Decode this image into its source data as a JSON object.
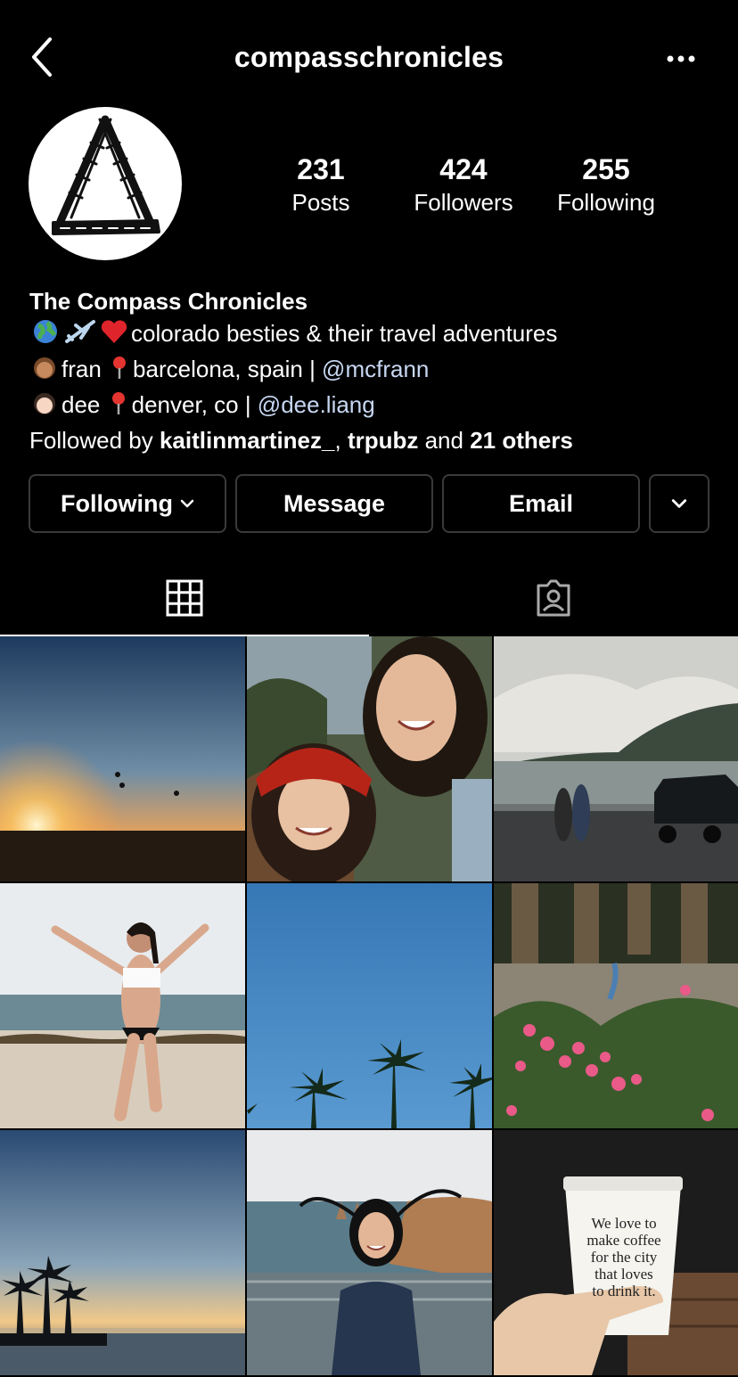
{
  "header": {
    "username": "compasschronicles",
    "back_icon": "chevron-left-icon",
    "more_icon": "more-horizontal-icon"
  },
  "stats": [
    {
      "value": "231",
      "label": "Posts"
    },
    {
      "value": "424",
      "label": "Followers"
    },
    {
      "value": "255",
      "label": "Following"
    }
  ],
  "bio": {
    "name": "The Compass Chronicles",
    "line1_text": "colorado besties & their travel adventures",
    "line2_name": "fran",
    "line2_loc": "barcelona, spain | ",
    "line2_handle": "@mcfrann",
    "line3_name": "dee",
    "line3_loc": "denver, co | ",
    "line3_handle": "@dee.liang",
    "followed_prefix": "Followed by ",
    "followed_user1": "kaitlinmartinez_",
    "followed_sep": ", ",
    "followed_user2": "trpubz",
    "followed_and": " and ",
    "followed_others": "21 others"
  },
  "buttons": {
    "following": "Following",
    "message": "Message",
    "email": "Email"
  },
  "tabs": {
    "grid_icon": "grid-icon",
    "tagged_icon": "tagged-person-icon",
    "active": "grid"
  },
  "colors": {
    "background": "#000000",
    "mention": "#c7d7f2",
    "button_border": "#3a3a3a"
  },
  "posts": [
    {
      "scene": "sunset-balloons"
    },
    {
      "scene": "selfie-two-friends"
    },
    {
      "scene": "coast-car"
    },
    {
      "scene": "beach-jump"
    },
    {
      "scene": "palm-sky"
    },
    {
      "scene": "flowers-palms"
    },
    {
      "scene": "palm-sunset"
    },
    {
      "scene": "cliff-windy"
    },
    {
      "scene": "coffee-cup"
    }
  ],
  "coffee_cup_text": [
    "We love to",
    "make coffee",
    "for the city",
    "that loves",
    "to drink it."
  ]
}
